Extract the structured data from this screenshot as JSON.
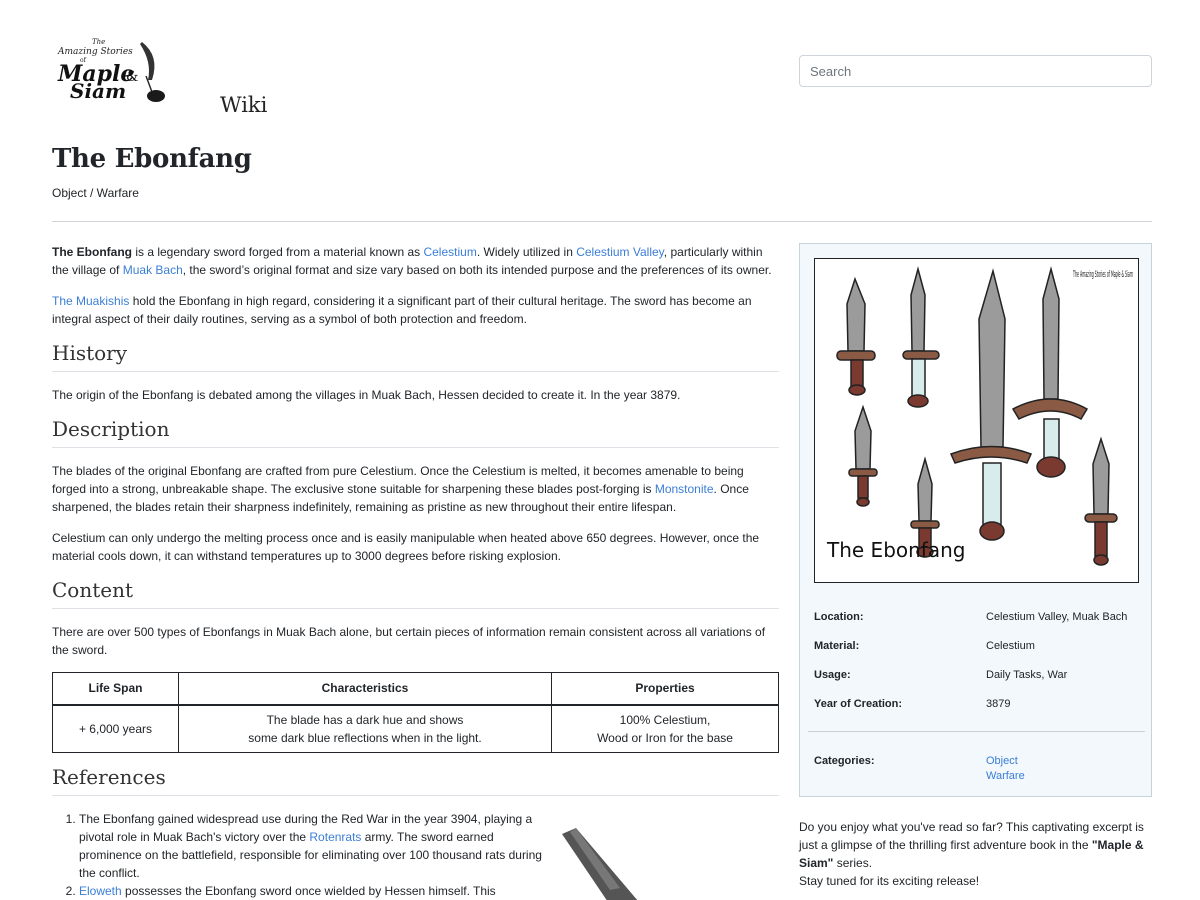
{
  "header": {
    "logo_text": "The Amazing Stories of Maple & Siam",
    "wiki_label": "Wiki",
    "search_placeholder": "Search"
  },
  "page": {
    "title": "The Ebonfang",
    "breadcrumb": "Object / Warfare"
  },
  "intro": {
    "p1": {
      "bold": "The Ebonfang",
      "t1": " is a legendary sword forged from a material known as ",
      "link1": "Celestium",
      "t2": ". Widely utilized in ",
      "link2": "Celestium Valley",
      "t3": ", particularly within the village of ",
      "link3": "Muak Bach",
      "t4": ", the sword’s original format and size vary based on both its intended purpose and the preferences of its owner."
    },
    "p2": {
      "link1": "The Muakishis",
      "t1": " hold the Ebonfang in high regard, considering it a significant part of their cultural heritage. The sword has become an integral aspect of their daily routines, serving as a symbol of both protection and freedom."
    }
  },
  "history": {
    "heading": "History",
    "text": "The origin of the Ebonfang is debated among the villages in Muak Bach, Hessen decided to create it. In the year 3879."
  },
  "description": {
    "heading": "Description",
    "p1_t1": "The blades of the original Ebonfang are crafted from pure Celestium. Once the Celestium is melted, it becomes amenable to being forged into a strong, unbreakable shape. The exclusive stone suitable for sharpening these blades post-forging is ",
    "p1_link": "Monstonite",
    "p1_t2": ". Once sharpened, the blades retain their sharpness indefinitely, remaining as pristine as new throughout their entire lifespan.",
    "p2": "Celestium can only undergo the melting process once and is easily manipulable when heated above 650 degrees. However, once the material cools down, it can withstand temperatures up to 3000 degrees before risking explosion."
  },
  "content": {
    "heading": "Content",
    "text": "There are over 500 types of Ebonfangs in Muak Bach alone, but certain pieces of information remain consistent across all variations of the sword.",
    "table": {
      "headers": [
        "Life Span",
        "Characteristics",
        "Properties"
      ],
      "row": {
        "lifespan": "+ 6,000 years",
        "char_l1": "The blade has a dark hue and shows",
        "char_l2": "some dark blue reflections when in the light.",
        "prop_l1": "100% Celestium,",
        "prop_l2": "Wood or Iron for the base"
      }
    }
  },
  "references": {
    "heading": "References",
    "r1_t1": "The Ebonfang gained widespread use during the Red War in the year 3904, playing a pivotal role in Muak Bach's victory over the ",
    "r1_link": "Rotenrats",
    "r1_t2": " army. The sword earned prominence on the battlefield, responsible for eliminating over 100 thousand rats during the conflict.",
    "r2_link": "Eloweth",
    "r2_t1": " possesses the Ebonfang sword once wielded by Hessen himself. This"
  },
  "infobox": {
    "image_caption": "The Ebonfang",
    "image_logo": "The Amazing Stories of Maple & Siam",
    "location_label": "Location:",
    "location_value": "Celestium Valley, Muak Bach",
    "material_label": "Material:",
    "material_value": "Celestium",
    "usage_label": "Usage:",
    "usage_value": "Daily Tasks, War",
    "year_label": "Year of Creation:",
    "year_value": "3879",
    "categories_label": "Categories:",
    "categories": [
      "Object",
      "Warfare"
    ]
  },
  "promo": {
    "t1": "Do you enjoy what you've read so far? This captivating excerpt is just a glimpse of the thrilling first adventure book in the ",
    "bold": "\"Maple & Siam\"",
    "t2": " series.",
    "line2": "Stay tuned for its exciting release!"
  },
  "colors": {
    "link": "#3b7ed6",
    "infobox_bg": "#f2f8fb",
    "text": "#212529"
  }
}
